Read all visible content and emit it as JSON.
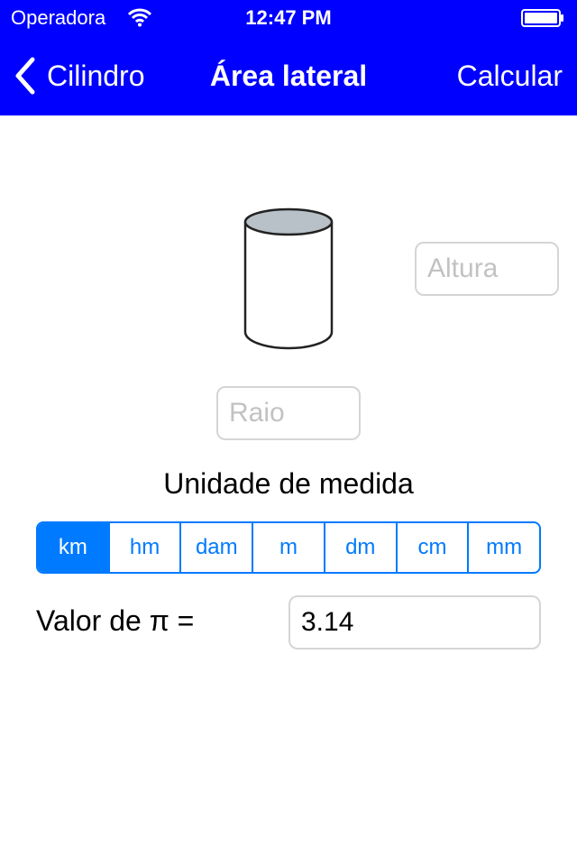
{
  "status_bar": {
    "carrier": "Operadora",
    "time": "12:47 PM"
  },
  "nav": {
    "back_label": "Cilindro",
    "title": "Área lateral",
    "action_label": "Calcular",
    "background_color": "#0000ff"
  },
  "inputs": {
    "altura_placeholder": "Altura",
    "raio_placeholder": "Raio"
  },
  "units": {
    "heading": "Unidade de medida",
    "options": [
      "km",
      "hm",
      "dam",
      "m",
      "dm",
      "cm",
      "mm"
    ],
    "selected": "km",
    "accent_color": "#007aff"
  },
  "pi": {
    "label": "Valor de π =",
    "value": "3.14"
  }
}
